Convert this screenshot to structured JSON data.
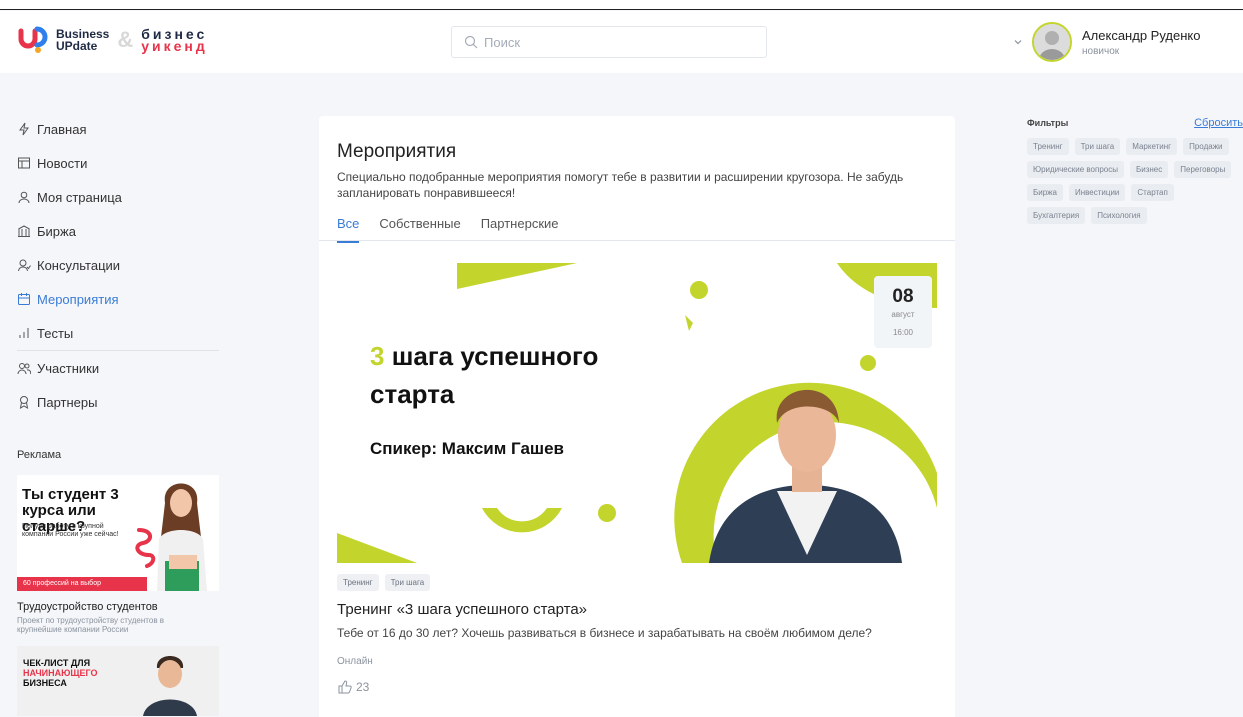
{
  "header": {
    "logo_brand_line1": "Business",
    "logo_brand_line2": "UPdate",
    "logo_amp": "&",
    "logo_ru_line1": "бизнес",
    "logo_ru_line2": "уикенд",
    "search_placeholder": "Поиск",
    "user_name": "Александр Руденко",
    "user_role": "новичок"
  },
  "sidebar": {
    "items": [
      {
        "label": "Главная",
        "icon": "bolt-icon"
      },
      {
        "label": "Новости",
        "icon": "news-icon"
      },
      {
        "label": "Моя страница",
        "icon": "user-icon"
      },
      {
        "label": "Биржа",
        "icon": "exchange-icon"
      },
      {
        "label": "Консультации",
        "icon": "consult-icon"
      },
      {
        "label": "Мероприятия",
        "icon": "calendar-icon",
        "active": true
      },
      {
        "label": "Тесты",
        "icon": "chart-icon"
      }
    ],
    "items2": [
      {
        "label": "Участники",
        "icon": "users-icon"
      },
      {
        "label": "Партнеры",
        "icon": "award-icon"
      }
    ],
    "ads_title": "Реклама",
    "ad1": {
      "headline": "Ты студент 3 курса или старше?",
      "sub": "Получи работу в крупной компании России уже сейчас!",
      "bar": "60 профессий на выбор",
      "caption": "Трудоустройство студентов",
      "desc": "Проект по трудоустройству студентов в крупнейшие компании России"
    },
    "ad2": {
      "line1": "ЧЕК-ЛИСТ ДЛЯ",
      "line2": "НАЧИНАЮЩЕГО",
      "line3": "БИЗНЕСА"
    }
  },
  "main": {
    "title": "Мероприятия",
    "description": "Специально подобранные мероприятия помогут тебе в развитии и расширении кругозора. Не забудь запланировать понравившееся!",
    "tabs": [
      {
        "label": "Все",
        "active": true
      },
      {
        "label": "Собственные"
      },
      {
        "label": "Партнерские"
      }
    ],
    "event": {
      "banner_num": "3",
      "banner_line1_rest": " шага успешного",
      "banner_line2": "старта",
      "banner_speaker": "Спикер: Максим Гашев",
      "date_day": "08",
      "date_month": "август",
      "date_time": "16:00",
      "tags": [
        "Тренинг",
        "Три шага"
      ],
      "title": "Тренинг «3 шага успешного старта»",
      "description": "Тебе от 16 до 30 лет? Хочешь развиваться в бизнесе и зарабатывать на своём любимом деле?",
      "format": "Онлайн",
      "likes": "23"
    }
  },
  "filters": {
    "title": "Фильтры",
    "reset": "Сбросить",
    "tags": [
      "Тренинг",
      "Три шага",
      "Маркетинг",
      "Продажи",
      "Юридические вопросы",
      "Бизнес",
      "Переговоры",
      "Биржа",
      "Инвестиции",
      "Стартап",
      "Бухгалтерия",
      "Психология"
    ]
  },
  "colors": {
    "accent": "#3a7bd5",
    "brand_green": "#c3d52c",
    "brand_red": "#e8344a",
    "brand_blue": "#2f80ed"
  }
}
